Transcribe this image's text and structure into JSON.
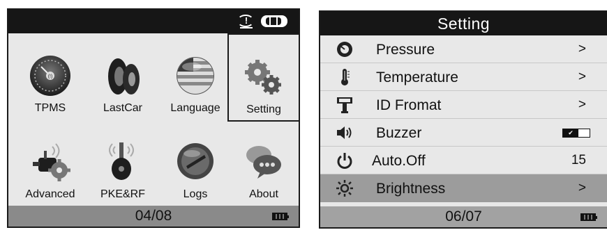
{
  "left_screen": {
    "page_indicator": "04/08",
    "apps": [
      {
        "label": "TPMS",
        "icon": "speedometer-icon"
      },
      {
        "label": "LastCar",
        "icon": "car-tire-icon"
      },
      {
        "label": "Language",
        "icon": "flag-globe-icon"
      },
      {
        "label": "Setting",
        "icon": "gears-icon",
        "selected": true
      },
      {
        "label": "Advanced",
        "icon": "sensor-gear-icon"
      },
      {
        "label": "PKE&RF",
        "icon": "key-signal-icon"
      },
      {
        "label": "Logs",
        "icon": "logs-disc-icon"
      },
      {
        "label": "About",
        "icon": "speech-bubbles-icon"
      }
    ]
  },
  "right_screen": {
    "title": "Setting",
    "items": [
      {
        "label": "Pressure",
        "value": ">",
        "icon": "pressure-icon"
      },
      {
        "label": "Temperature",
        "value": ">",
        "icon": "thermometer-icon"
      },
      {
        "label": "ID Fromat",
        "value": ">",
        "icon": "id-format-icon"
      },
      {
        "label": "Buzzer",
        "value": "",
        "icon": "speaker-icon",
        "toggle": "on"
      },
      {
        "label": "Auto.Off",
        "value": "15",
        "icon": "power-icon"
      },
      {
        "label": "Brightness",
        "value": ">",
        "icon": "sun-icon",
        "selected": true
      }
    ],
    "page_indicator": "06/07"
  }
}
